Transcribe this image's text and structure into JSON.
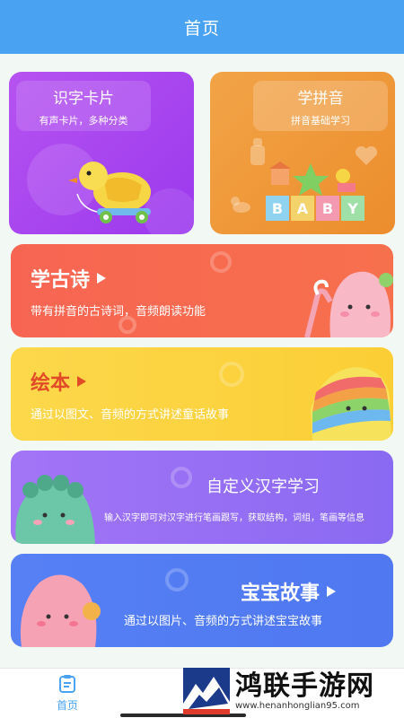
{
  "header": {
    "title": "首页"
  },
  "cards_top": [
    {
      "title": "识字卡片",
      "subtitle": "有声卡片，多种分类"
    },
    {
      "title": "学拼音",
      "subtitle": "拼音基础学习",
      "blocks": [
        "B",
        "A",
        "B",
        "Y"
      ]
    }
  ],
  "cards_wide": [
    {
      "title": "学古诗",
      "subtitle": "带有拼音的古诗词，音频朗读功能"
    },
    {
      "title": "绘本",
      "subtitle": "通过以图文、音频的方式讲述童话故事"
    },
    {
      "title": "自定义汉字学习",
      "subtitle": "输入汉字即可对汉字进行笔画跟写，获取结构，词组，笔画等信息"
    },
    {
      "title": "宝宝故事",
      "subtitle": "通过以图片、音频的方式讲述宝宝故事"
    }
  ],
  "tabbar": {
    "home_label": "首页"
  },
  "watermark": {
    "text": "鸿联手游网",
    "url": "www.henanhonglian95.com"
  },
  "colors": {
    "header": "#4aa3f2",
    "purple_card": "#a845f0",
    "orange_card": "#ef9838",
    "red_card": "#f76a50",
    "yellow_card": "#fcd340",
    "violet_card": "#9a6ff4",
    "blue_card": "#527cf2"
  }
}
